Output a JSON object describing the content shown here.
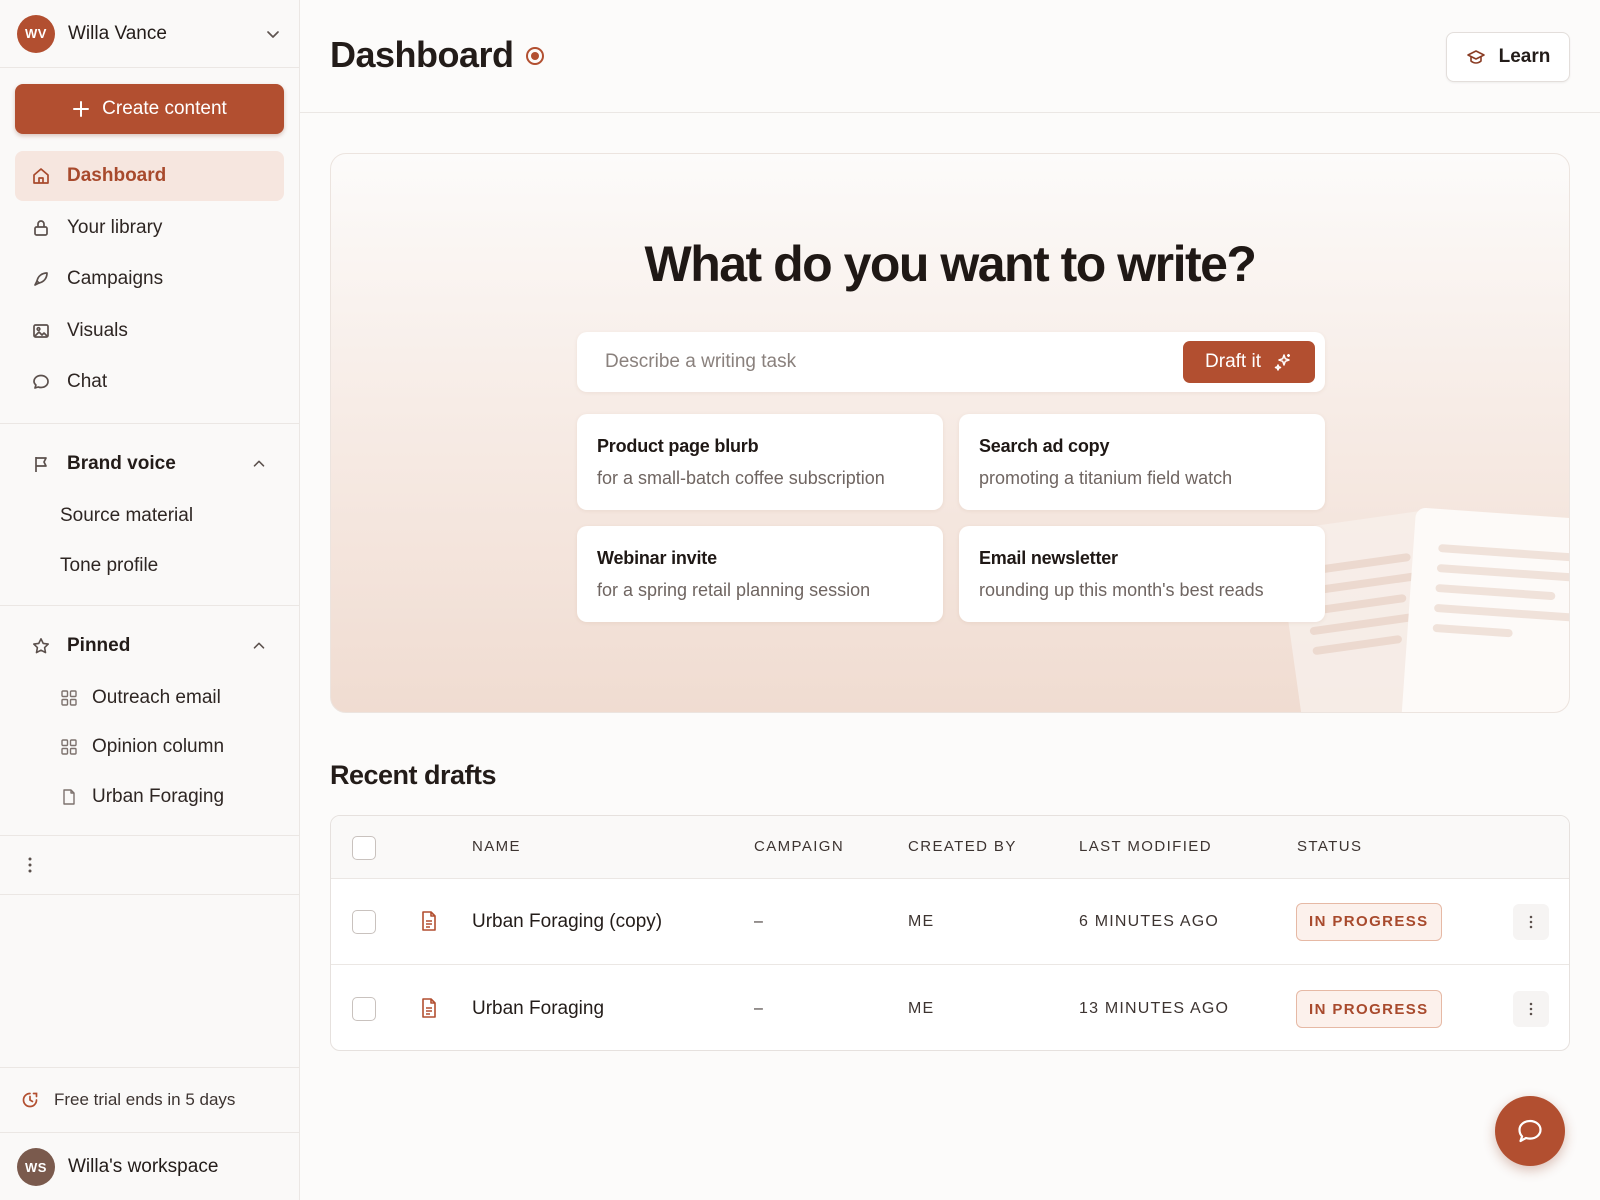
{
  "workspace": {
    "user_initials": "WV",
    "user_name": "Willa Vance",
    "workspace_initials": "WS",
    "workspace_name": "Willa's workspace"
  },
  "sidebar": {
    "create_label": "Create content",
    "nav": [
      {
        "label": "Dashboard",
        "icon": "home-icon",
        "active": true
      },
      {
        "label": "Your library",
        "icon": "lock-icon"
      },
      {
        "label": "Campaigns",
        "icon": "rocket-icon"
      },
      {
        "label": "Visuals",
        "icon": "image-icon"
      },
      {
        "label": "Chat",
        "icon": "chat-bubble-icon"
      }
    ],
    "brand_voice": {
      "label": "Brand voice",
      "items": [
        "Source material",
        "Tone profile"
      ]
    },
    "pinned": {
      "label": "Pinned",
      "items": [
        {
          "label": "Outreach email",
          "icon": "grid-icon"
        },
        {
          "label": "Opinion column",
          "icon": "grid-icon"
        },
        {
          "label": "Urban Foraging",
          "icon": "file-icon"
        }
      ]
    },
    "trial_text": "Free trial ends in 5 days"
  },
  "header": {
    "title": "Dashboard",
    "learn_label": "Learn"
  },
  "hero": {
    "title": "What do you want to write?",
    "input_placeholder": "Describe a writing task",
    "draft_label": "Draft it",
    "ideas": [
      {
        "title": "Product page blurb",
        "subtitle": "for a small-batch coffee subscription"
      },
      {
        "title": "Search ad copy",
        "subtitle": "promoting a titanium field watch"
      },
      {
        "title": "Webinar invite",
        "subtitle": "for a spring retail planning session"
      },
      {
        "title": "Email newsletter",
        "subtitle": "rounding up this month's best reads"
      }
    ]
  },
  "drafts": {
    "title": "Recent drafts",
    "columns": [
      "NAME",
      "CAMPAIGN",
      "CREATED BY",
      "LAST MODIFIED",
      "STATUS"
    ],
    "rows": [
      {
        "name": "Urban Foraging (copy)",
        "campaign": "–",
        "created_by": "ME",
        "modified": "6 MINUTES AGO",
        "status": "IN PROGRESS"
      },
      {
        "name": "Urban Foraging",
        "campaign": "–",
        "created_by": "ME",
        "modified": "13 MINUTES AGO",
        "status": "IN PROGRESS"
      }
    ]
  },
  "colors": {
    "accent": "#b24f30",
    "accent_light": "#f6e6df",
    "text": "#231c19"
  }
}
